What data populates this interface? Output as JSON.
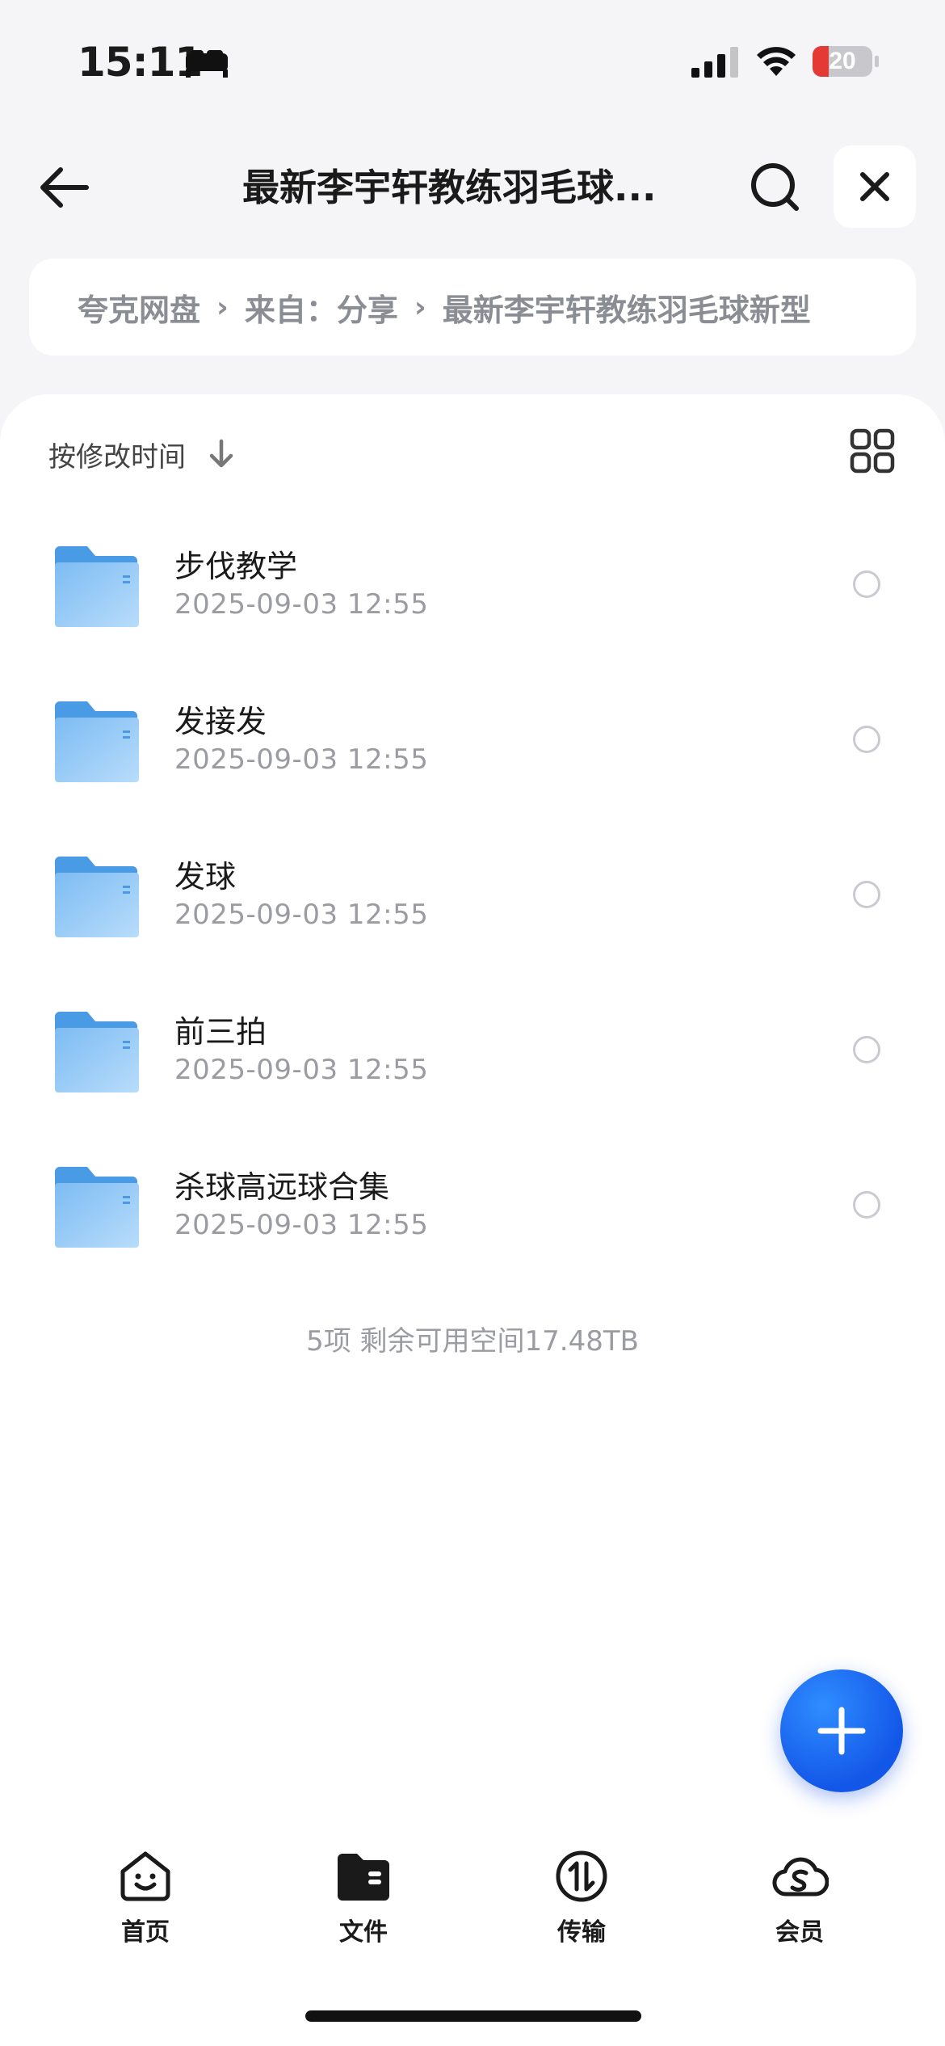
{
  "status_bar": {
    "time": "15:11",
    "battery_level": "20",
    "colors": {
      "battery_low": "#e53935"
    }
  },
  "nav": {
    "title": "最新李宇轩教练羽毛球...",
    "icons": {
      "back": "arrow-left-icon",
      "search": "search-icon",
      "close": "close-icon"
    }
  },
  "breadcrumb": {
    "items": [
      "夸克网盘",
      "来自：分享",
      "最新李宇轩教练羽毛球新型"
    ]
  },
  "sort": {
    "label": "按修改时间"
  },
  "files": [
    {
      "name": "步伐教学",
      "date": "2025-09-03 12:55"
    },
    {
      "name": "发接发",
      "date": "2025-09-03 12:55"
    },
    {
      "name": "发球",
      "date": "2025-09-03 12:55"
    },
    {
      "name": "前三拍",
      "date": "2025-09-03 12:55"
    },
    {
      "name": "杀球高远球合集",
      "date": "2025-09-03 12:55"
    }
  ],
  "summary": "5项 剩余可用空间17.48TB",
  "tabs": [
    {
      "label": "首页",
      "icon": "smiley-home-icon"
    },
    {
      "label": "文件",
      "icon": "folder-icon"
    },
    {
      "label": "传输",
      "icon": "transfer-icon"
    },
    {
      "label": "会员",
      "icon": "cloud-s-icon"
    }
  ],
  "colors": {
    "accent": "#1a63f0",
    "folder": "#5aa6ee"
  }
}
